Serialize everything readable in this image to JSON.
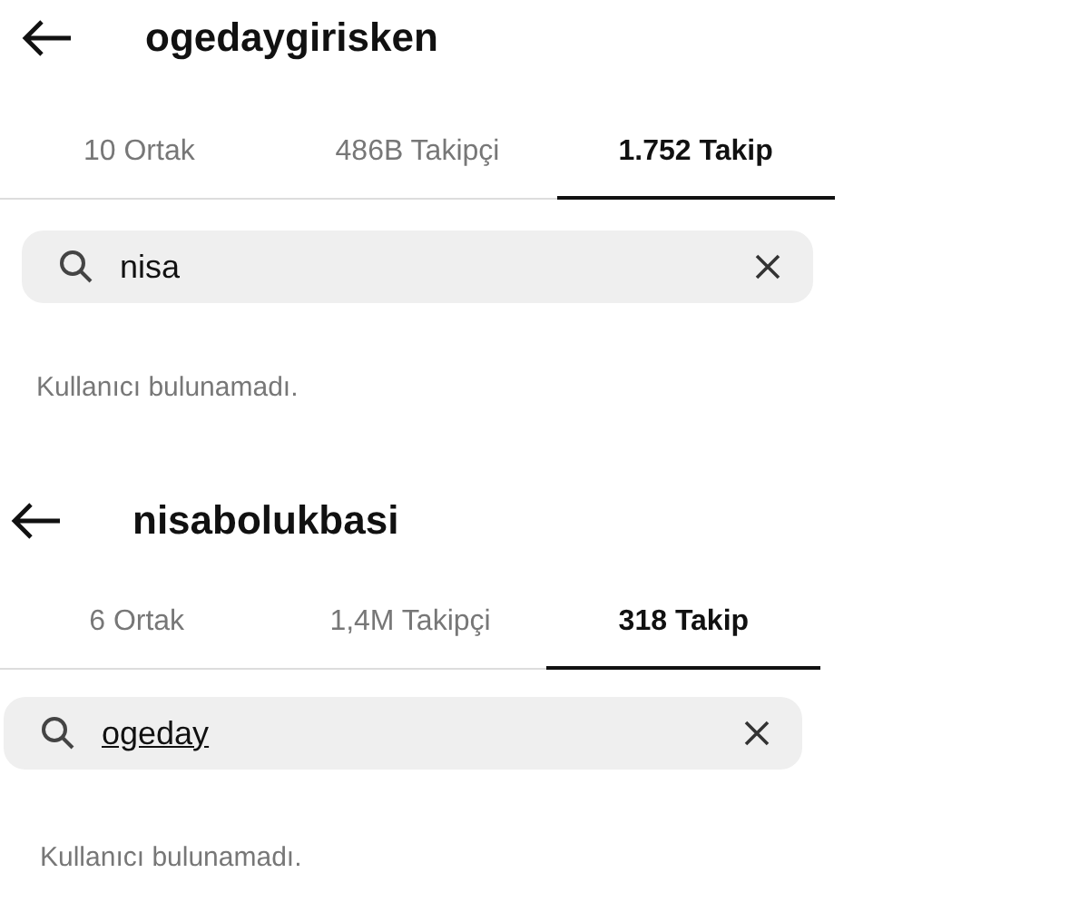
{
  "panels": [
    {
      "username": "ogedaygirisken",
      "tabs": [
        {
          "label": "10 Ortak",
          "selected": false
        },
        {
          "label": "486B Takipçi",
          "selected": false
        },
        {
          "label": "1.752 Takip",
          "selected": true
        }
      ],
      "search": {
        "value": "nisa",
        "underlined": false
      },
      "message": "Kullanıcı bulunamadı."
    },
    {
      "username": "nisabolukbasi",
      "tabs": [
        {
          "label": "6 Ortak",
          "selected": false
        },
        {
          "label": "1,4M Takipçi",
          "selected": false
        },
        {
          "label": "318 Takip",
          "selected": true
        }
      ],
      "search": {
        "value": "ogeday",
        "underlined": true
      },
      "message": "Kullanıcı bulunamadı."
    }
  ]
}
